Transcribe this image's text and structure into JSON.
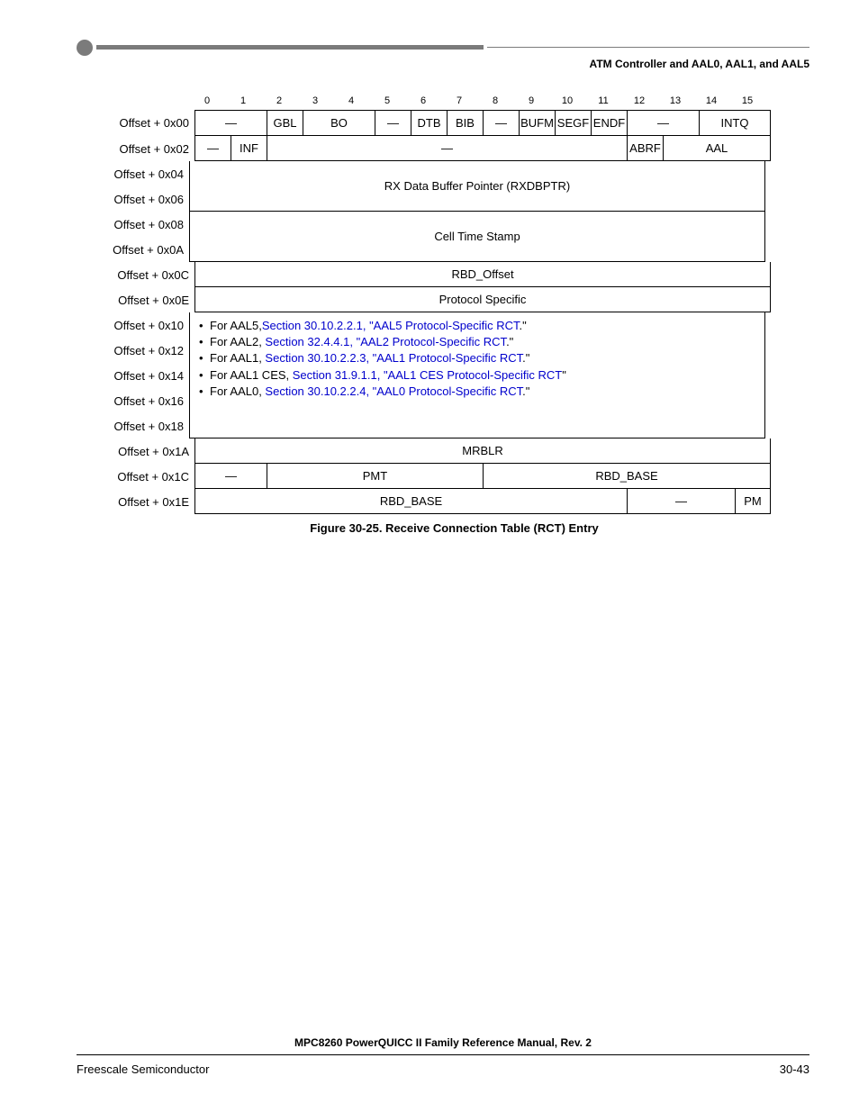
{
  "header": {
    "title": "ATM Controller and AAL0, AAL1, and AAL5"
  },
  "bits": [
    "0",
    "1",
    "2",
    "3",
    "4",
    "5",
    "6",
    "7",
    "8",
    "9",
    "10",
    "11",
    "12",
    "13",
    "14",
    "15"
  ],
  "rows": {
    "r00": {
      "label": "Offset + 0x00",
      "cells": [
        {
          "w": 2,
          "v": "—"
        },
        {
          "w": 1,
          "v": "GBL"
        },
        {
          "w": 2,
          "v": "BO"
        },
        {
          "w": 1,
          "v": "—"
        },
        {
          "w": 1,
          "v": "DTB"
        },
        {
          "w": 1,
          "v": "BIB"
        },
        {
          "w": 1,
          "v": "—"
        },
        {
          "w": 1,
          "v": "BUFM"
        },
        {
          "w": 1,
          "v": "SEGF"
        },
        {
          "w": 1,
          "v": "ENDF"
        },
        {
          "w": 2,
          "v": "—"
        },
        {
          "w": 2,
          "v": "INTQ"
        }
      ]
    },
    "r02": {
      "label": "Offset + 0x02",
      "cells": [
        {
          "w": 1,
          "v": "—"
        },
        {
          "w": 1,
          "v": "INF"
        },
        {
          "w": 10,
          "v": "—"
        },
        {
          "w": 1,
          "v": "ABRF"
        },
        {
          "w": 3,
          "v": "AAL"
        }
      ]
    },
    "r04": {
      "label": "Offset + 0x04",
      "full": "RX Data Buffer Pointer (RXDBPTR)"
    },
    "r06": {
      "label": "Offset + 0x06"
    },
    "r08": {
      "label": "Offset + 0x08",
      "full": "Cell Time Stamp"
    },
    "r0A": {
      "label": "Offset + 0x0A"
    },
    "r0C": {
      "label": "Offset + 0x0C",
      "full": "RBD_Offset"
    },
    "r0E": {
      "label": "Offset + 0x0E",
      "full": "Protocol Specific"
    },
    "proto_labels": [
      "Offset + 0x10",
      "Offset + 0x12",
      "Offset + 0x14",
      "Offset + 0x16",
      "Offset + 0x18"
    ],
    "proto_items": [
      {
        "pre": "For AAL5,",
        "link": "Section 30.10.2.2.1, \"AAL5 Protocol-Specific RCT",
        "post": ".\""
      },
      {
        "pre": "For AAL2, ",
        "link": "Section 32.4.4.1, \"AAL2 Protocol-Specific RCT",
        "post": ".\""
      },
      {
        "pre": "For AAL1, ",
        "link": "Section 30.10.2.2.3, \"AAL1 Protocol-Specific RCT",
        "post": ".\""
      },
      {
        "pre": "For AAL1 CES, ",
        "link": "Section 31.9.1.1, \"AAL1 CES Protocol-Specific RCT",
        "post": "\""
      },
      {
        "pre": "For AAL0, ",
        "link": "Section 30.10.2.2.4, \"AAL0 Protocol-Specific RCT",
        "post": ".\""
      }
    ],
    "r1A": {
      "label": "Offset + 0x1A",
      "full": "MRBLR"
    },
    "r1C": {
      "label": "Offset + 0x1C",
      "cells": [
        {
          "w": 2,
          "v": "—"
        },
        {
          "w": 6,
          "v": "PMT"
        },
        {
          "w": 8,
          "v": "RBD_BASE"
        }
      ]
    },
    "r1E": {
      "label": "Offset + 0x1E",
      "cells": [
        {
          "w": 12,
          "v": "RBD_BASE"
        },
        {
          "w": 3,
          "v": "—"
        },
        {
          "w": 1,
          "v": "PM"
        }
      ]
    }
  },
  "caption": "Figure 30-25. Receive Connection Table (RCT) Entry",
  "footer": {
    "manual": "MPC8260 PowerQUICC II Family Reference Manual, Rev. 2",
    "left": "Freescale Semiconductor",
    "right": "30-43"
  }
}
